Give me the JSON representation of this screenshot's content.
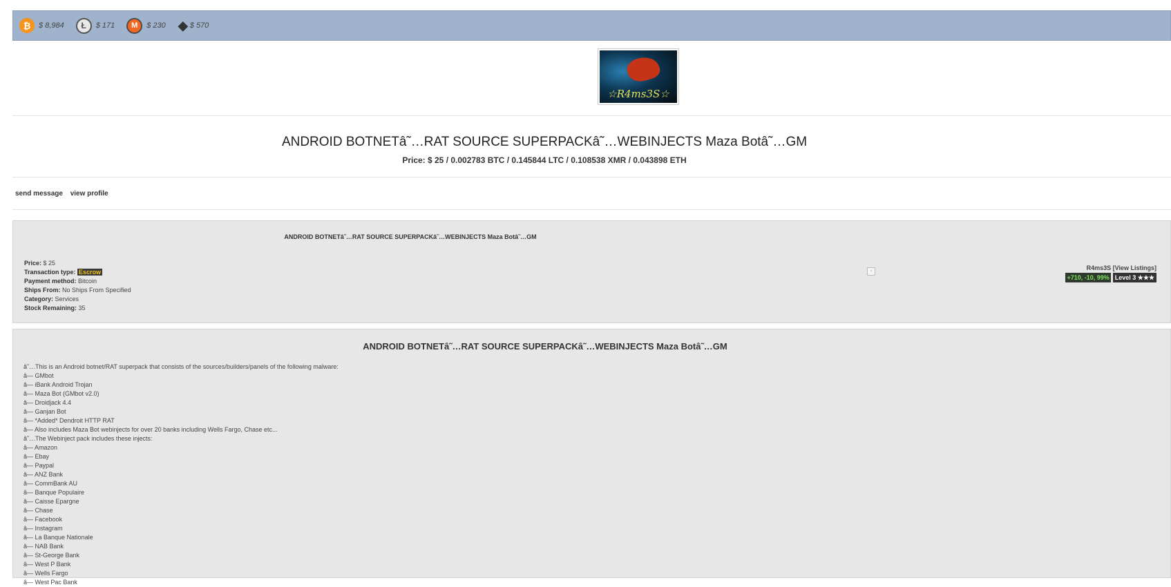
{
  "ticker": [
    {
      "icon": "bitcoin-icon",
      "glyph": "₿",
      "price": "$ 8,984"
    },
    {
      "icon": "litecoin-icon",
      "glyph": "Ł",
      "price": "$ 171"
    },
    {
      "icon": "monero-icon",
      "glyph": "M",
      "price": "$ 230"
    },
    {
      "icon": "ethereum-icon",
      "glyph": "◆",
      "price": "$ 570"
    }
  ],
  "vendor_logo_text": "☆R4ms3S☆",
  "header": {
    "title": "ANDROID BOTNETâ˜…RAT SOURCE SUPERPACKâ˜…WEBINJECTS Maza Botâ˜…GM",
    "price_line": "Price: $ 25 / 0.002783 BTC / 0.145844 LTC / 0.108538 XMR / 0.043898 ETH"
  },
  "links": {
    "send_message": "send message",
    "view_profile": "view profile"
  },
  "listing": {
    "title": "ANDROID BOTNETâ˜…RAT SOURCE SUPERPACKâ˜…WEBINJECTS Maza Botâ˜…GM",
    "price_label": "Price:",
    "price": "$ 25",
    "transaction_label": "Transaction type:",
    "transaction": "Escrow",
    "payment_label": "Payment method:",
    "payment": "Bitcoin",
    "ships_label": "Ships From:",
    "ships": "No Ships From Specified",
    "category_label": "Category:",
    "category": "Services",
    "stock_label": "Stock Remaining:",
    "stock": "35"
  },
  "seller": {
    "name_line": "R4ms3S [View Listings]",
    "feedback": "+710, -10, 99%",
    "level": "Level 3 ★★★"
  },
  "description": {
    "title": "ANDROID BOTNETâ˜…RAT SOURCE SUPERPACKâ˜…WEBINJECTS Maza Botâ˜…GM",
    "lines": [
      "â˜…This is an Android botnet/RAT superpack that consists of the sources/builders/panels of the following malware:",
      "â— GMbot",
      "â— iBank Android Trojan",
      "â— Maza Bot (GMbot v2.0)",
      "â— Droidjack 4.4",
      "â— Ganjan Bot",
      "â— *Added* Dendroit HTTP RAT",
      "â— Also includes Maza Bot webinjects for over 20 banks including Wells Fargo, Chase etc...",
      "â˜…The Webinject pack includes these injects:",
      "â— Amazon",
      "â— Ebay",
      "â— Paypal",
      "â— ANZ Bank",
      "â— CommBank AU",
      "â— Banque Populaire",
      "â— Caisse Epargne",
      "â— Chase",
      "â— Facebook",
      "â— Instagram",
      "â— La Banque Nationale",
      "â— NAB Bank",
      "â— St-George Bank",
      "â— West P Bank",
      "â— Wells Fargo",
      "â— West Pac Bank"
    ]
  }
}
